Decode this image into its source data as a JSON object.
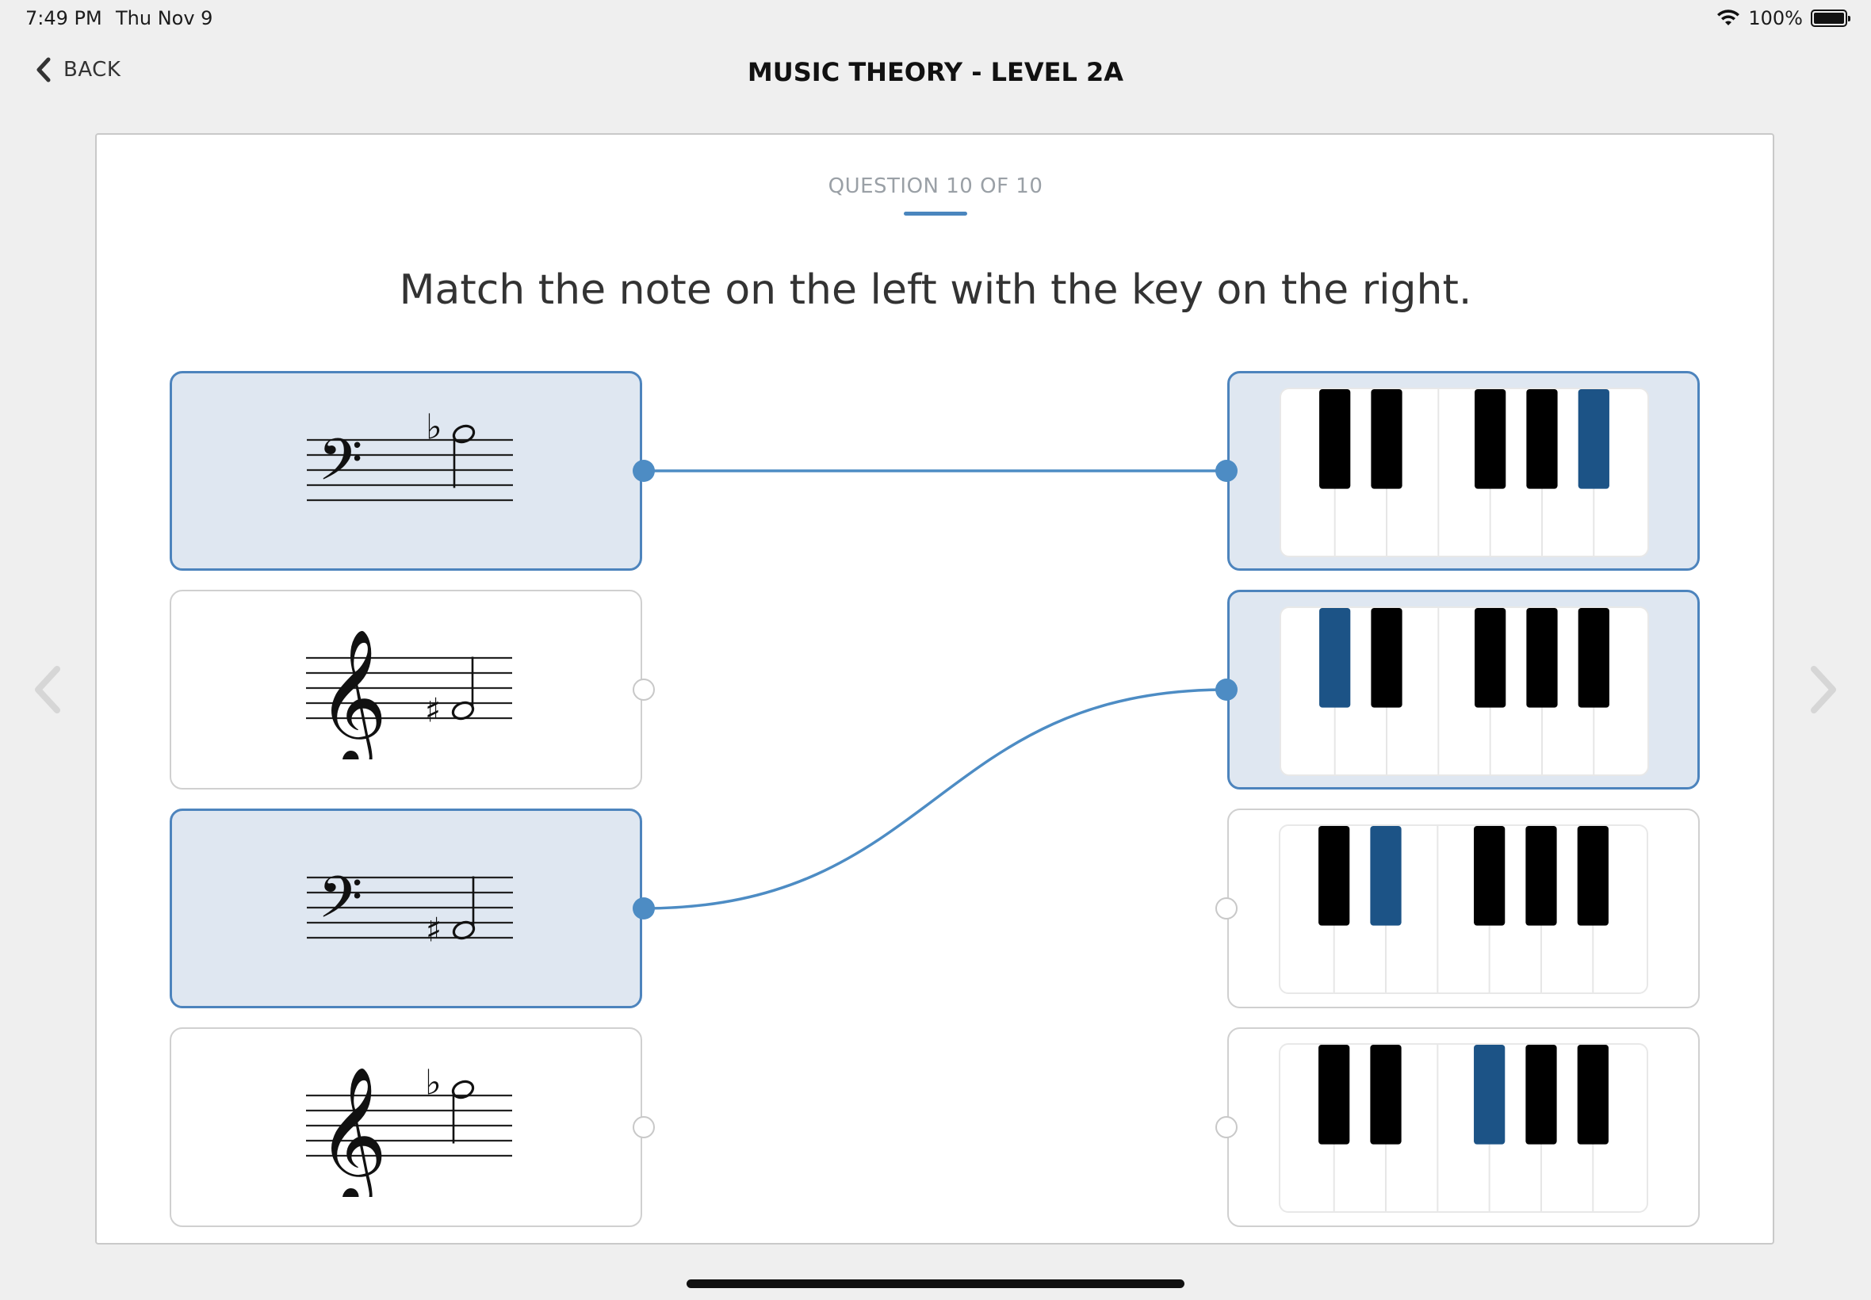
{
  "status_bar": {
    "time": "7:49 PM",
    "date": "Thu Nov 9",
    "battery": "100%"
  },
  "nav": {
    "back_label": "BACK",
    "title": "MUSIC THEORY - LEVEL 2A"
  },
  "question": {
    "counter": "QUESTION 10 OF 10",
    "prompt": "Match the note on the left with the key on the right."
  },
  "notes": [
    {
      "clef": "bass",
      "accidental": "flat",
      "selected": true
    },
    {
      "clef": "treble",
      "accidental": "sharp",
      "selected": false
    },
    {
      "clef": "bass",
      "accidental": "sharp",
      "selected": true
    },
    {
      "clef": "treble",
      "accidental": "flat",
      "selected": false
    }
  ],
  "keys": [
    {
      "highlighted_black_key": 5,
      "selected": true
    },
    {
      "highlighted_black_key": 1,
      "selected": true
    },
    {
      "highlighted_black_key": 2,
      "selected": false
    },
    {
      "highlighted_black_key": 3,
      "selected": false
    }
  ],
  "matches": [
    {
      "note": 1,
      "key": 1
    },
    {
      "note": 3,
      "key": 2
    }
  ],
  "colors": {
    "accent": "#4d8cc4",
    "highlight_key": "#1c5386",
    "selected_fill": "#dfe7f1",
    "selected_border": "#4d84bd"
  },
  "icons": {
    "back": "chevron-left-icon",
    "wifi": "wifi-icon",
    "battery": "battery-icon",
    "prev": "chevron-left-icon",
    "next": "chevron-right-icon"
  }
}
